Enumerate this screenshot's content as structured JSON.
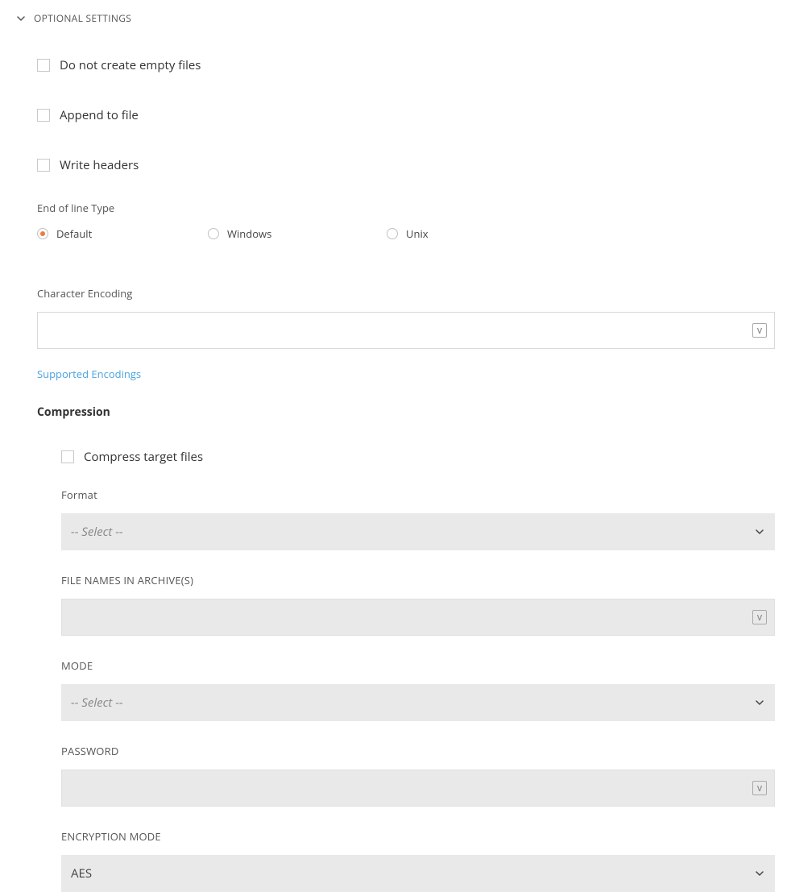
{
  "header": {
    "title": "OPTIONAL SETTINGS"
  },
  "checkboxes": {
    "no_empty": "Do not create empty files",
    "append": "Append to file",
    "write_headers": "Write headers"
  },
  "eol": {
    "label": "End of line Type",
    "options": {
      "default": "Default",
      "windows": "Windows",
      "unix": "Unix"
    }
  },
  "encoding": {
    "label": "Character Encoding",
    "link": "Supported Encodings"
  },
  "compression": {
    "title": "Compression",
    "compress_label": "Compress target files",
    "format_label": "Format",
    "format_placeholder": "-- Select --",
    "filenames_label": "FILE NAMES IN ARCHIVE(S)",
    "mode_label": "MODE",
    "mode_placeholder": "-- Select --",
    "password_label": "PASSWORD",
    "encryption_label": "ENCRYPTION MODE",
    "encryption_value": "AES"
  },
  "icons": {
    "variable_glyph": "V"
  }
}
